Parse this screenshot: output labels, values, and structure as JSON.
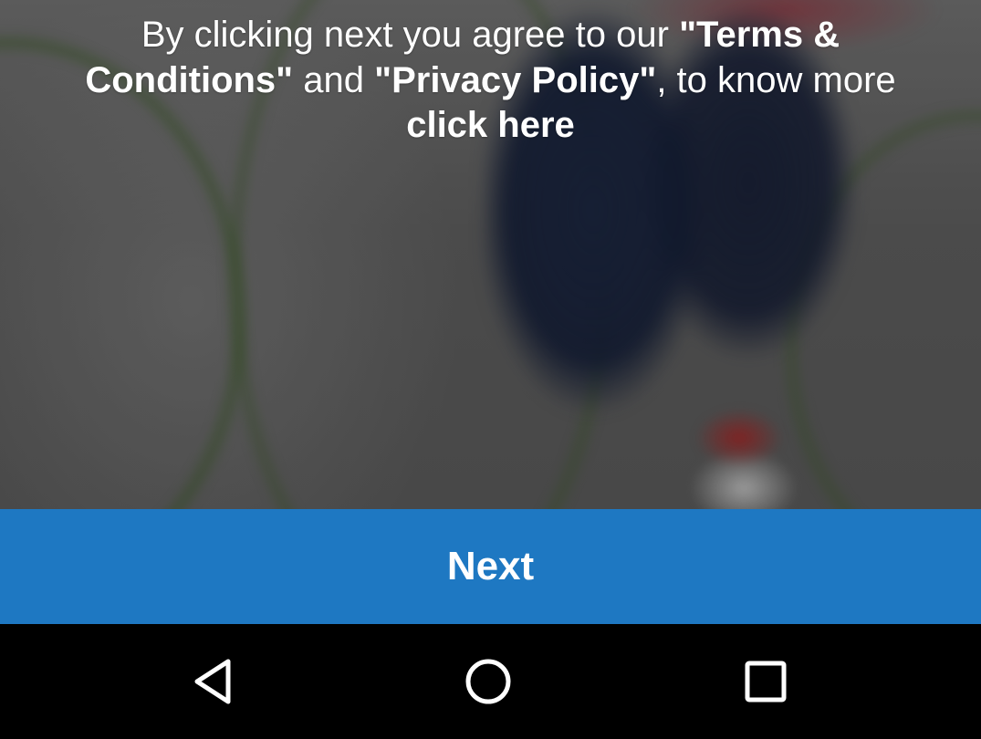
{
  "notice": {
    "part1": "By clicking next you agree to our ",
    "terms_link": "\"Terms & Conditions\"",
    "part2": " and ",
    "privacy_link": "\"Privacy Policy\"",
    "part3": ", to know more",
    "click_here": "click here"
  },
  "next_button": {
    "label": "Next"
  },
  "nav": {
    "back_icon": "back-triangle-icon",
    "home_icon": "home-circle-icon",
    "recents_icon": "recents-square-icon"
  },
  "colors": {
    "next_button_bg": "#1e78c2",
    "navbar_bg": "#000000",
    "text": "#ffffff"
  }
}
